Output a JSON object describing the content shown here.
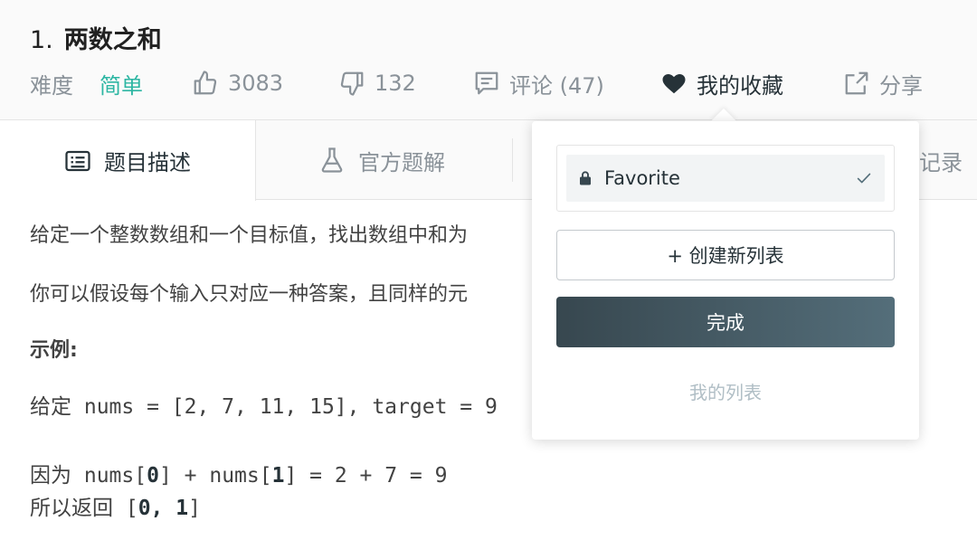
{
  "problem": {
    "number": "1.",
    "title": "两数之和"
  },
  "meta": {
    "difficulty_label": "难度",
    "difficulty_value": "简单",
    "likes": "3083",
    "dislikes": "132",
    "comments": "评论 (47)",
    "favorite": "我的收藏",
    "share": "分享"
  },
  "tabs": {
    "description": "题目描述",
    "solution": "官方题解",
    "record": "记录"
  },
  "content": {
    "p1": "给定一个整数数组和一个目标值，找出数组中和为",
    "p2": "你可以假设每个输入只对应一种答案，且同样的元",
    "example_label": "示例:",
    "code_given_cn": "给定",
    "code_given_rest": " nums = [2, 7, 11, 15], target = 9",
    "code_because_cn": "因为",
    "code_because_a": " nums[",
    "code_because_b": "0",
    "code_because_c": "] + nums[",
    "code_because_d": "1",
    "code_because_e": "] = 2 + 7 = 9",
    "code_return_cn": "所以返回",
    "code_return_a": " [",
    "code_return_b": "0, 1",
    "code_return_c": "]"
  },
  "popover": {
    "list_item": "Favorite",
    "create_button": "+ 创建新列表",
    "done_button": "完成",
    "my_lists_link": "我的列表"
  },
  "colors": {
    "accent_easy": "#2db6a3",
    "done_button": "#37474f"
  }
}
